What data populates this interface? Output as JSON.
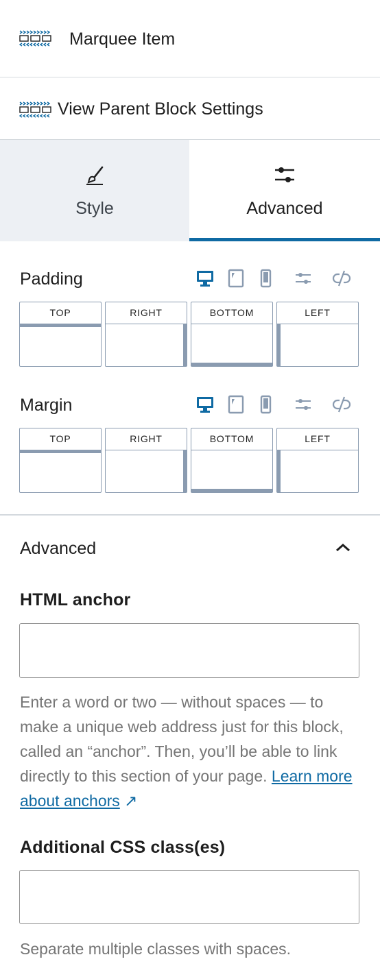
{
  "header": {
    "title": "Marquee Item",
    "icon": "marquee-block-icon"
  },
  "parent_link": {
    "label": "View Parent Block Settings",
    "icon": "marquee-block-icon"
  },
  "tabs": [
    {
      "label": "Style",
      "icon": "paintbrush-icon",
      "active": false
    },
    {
      "label": "Advanced",
      "icon": "sliders-icon",
      "active": true
    }
  ],
  "padding": {
    "label": "Padding",
    "sides": [
      "TOP",
      "RIGHT",
      "BOTTOM",
      "LEFT"
    ],
    "device_icons": [
      "desktop-icon",
      "tablet-icon",
      "mobile-icon",
      "sliders-icon",
      "unlink-icon"
    ]
  },
  "margin": {
    "label": "Margin",
    "sides": [
      "TOP",
      "RIGHT",
      "BOTTOM",
      "LEFT"
    ],
    "device_icons": [
      "desktop-icon",
      "tablet-icon",
      "mobile-icon",
      "sliders-icon",
      "unlink-icon"
    ]
  },
  "advanced_panel": {
    "title": "Advanced",
    "expanded": true,
    "html_anchor": {
      "label": "HTML anchor",
      "value": "",
      "help_text": "Enter a word or two — without spaces — to make a unique web address just for this block, called an “anchor”. Then, you’ll be able to link directly to this section of your page.",
      "link_text": "Learn more about anchors",
      "link_glyph": "↗"
    },
    "css_classes": {
      "label": "Additional CSS class(es)",
      "value": "",
      "help_text": "Separate multiple classes with spaces."
    }
  },
  "colors": {
    "accent": "#0f6aa3",
    "active_device": "#0f6aa3",
    "muted_icon": "#8a9bb0",
    "style_tab_bg": "#edf0f4",
    "help_text": "#757575"
  }
}
